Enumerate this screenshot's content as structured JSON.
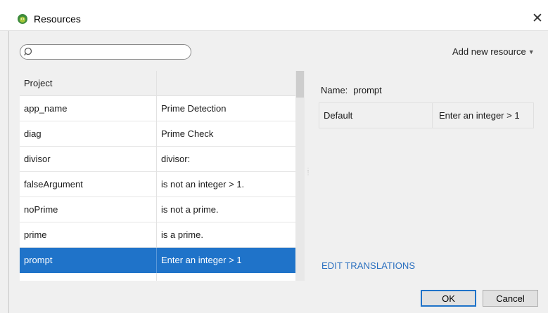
{
  "window": {
    "title": "Resources",
    "close_glyph": "✕",
    "app_icon": "android-icon"
  },
  "toolbar": {
    "search": {
      "value": "",
      "placeholder": ""
    },
    "add_new_resource": "Add new resource"
  },
  "table": {
    "header": [
      "Project",
      ""
    ],
    "rows": [
      {
        "name": "app_name",
        "value": "Prime Detection"
      },
      {
        "name": "diag",
        "value": "Prime Check"
      },
      {
        "name": "divisor",
        "value": "divisor:"
      },
      {
        "name": "falseArgument",
        "value": "is not an integer > 1."
      },
      {
        "name": "noPrime",
        "value": "is not a prime."
      },
      {
        "name": "prime",
        "value": "is a prime."
      },
      {
        "name": "prompt",
        "value": "Enter an integer > 1"
      }
    ],
    "selected_index": 6
  },
  "detail": {
    "name_label": "Name:",
    "name_value": "prompt",
    "translations": [
      {
        "locale": "Default",
        "value": "Enter an integer > 1"
      }
    ],
    "edit_translations": "EDIT TRANSLATIONS"
  },
  "buttons": {
    "ok": "OK",
    "cancel": "Cancel"
  },
  "colors": {
    "selection": "#1f73c9",
    "link": "#2a6fbf",
    "background": "#f0f0f0"
  }
}
